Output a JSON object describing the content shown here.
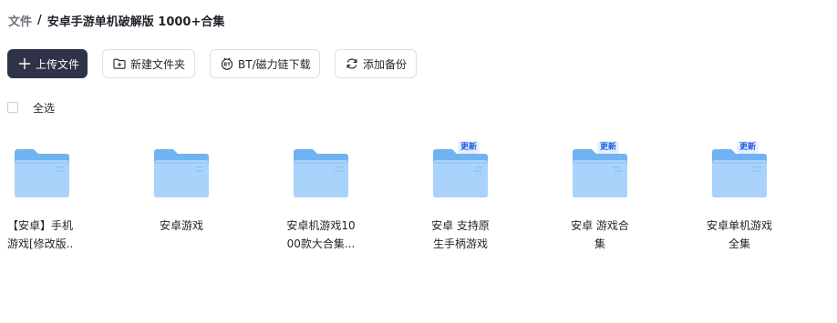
{
  "breadcrumb": {
    "root": "文件",
    "separator": "/",
    "current": "安卓手游单机破解版 1000+合集"
  },
  "toolbar": {
    "upload_label": "上传文件",
    "new_folder_label": "新建文件夹",
    "bt_label": "BT/磁力链下载",
    "backup_label": "添加备份"
  },
  "select_all": {
    "label": "全选"
  },
  "folders": [
    {
      "name_line1": "【安卓】手机",
      "name_line2": "游戏[修改版..",
      "badge": ""
    },
    {
      "name_line1": "安卓游戏",
      "name_line2": "",
      "badge": ""
    },
    {
      "name_line1": "安卓机游戏10",
      "name_line2": "00款大合集...",
      "badge": ""
    },
    {
      "name_line1": "安卓 支持原",
      "name_line2": "生手柄游戏",
      "badge": "更新"
    },
    {
      "name_line1": "安卓 游戏合",
      "name_line2": "集",
      "badge": "更新"
    },
    {
      "name_line1": "安卓单机游戏",
      "name_line2": "全集",
      "badge": "更新"
    }
  ],
  "colors": {
    "primary_button": "#2f3349",
    "folder_front": "#a9d3fb",
    "folder_back": "#6fb3f2",
    "badge_text": "#1f5fe0",
    "badge_bg": "#e7efff"
  }
}
